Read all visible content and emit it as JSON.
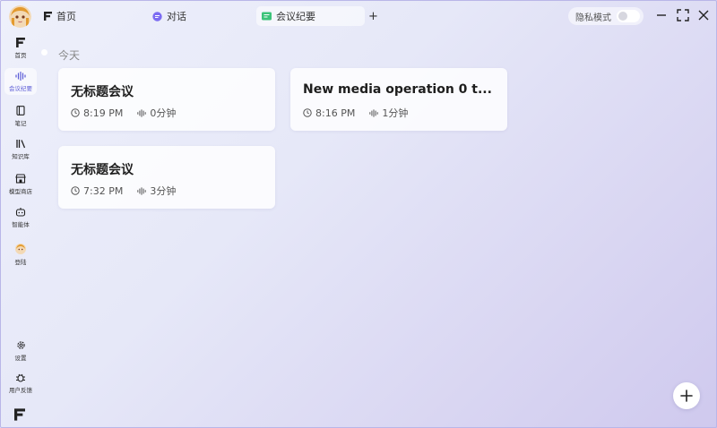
{
  "titlebar": {
    "tabs": [
      {
        "label": "首页"
      },
      {
        "label": "对话"
      },
      {
        "label": "会议纪要"
      }
    ],
    "add_tab": "+",
    "privacy_label": "隐私模式",
    "privacy_on": false
  },
  "sidebar": {
    "items": [
      {
        "label": "首页"
      },
      {
        "label": "会议纪要"
      },
      {
        "label": "笔记"
      },
      {
        "label": "知识库"
      },
      {
        "label": "模型商店"
      },
      {
        "label": "智能体"
      },
      {
        "label": "登陆"
      }
    ],
    "bottom": [
      {
        "label": "设置"
      },
      {
        "label": "用户反馈"
      }
    ]
  },
  "main": {
    "section": "今天",
    "cards": [
      {
        "title": "无标题会议",
        "time": "8:19 PM",
        "duration": "0分钟"
      },
      {
        "title": "New media operation 0 t...",
        "time": "8:16 PM",
        "duration": "1分钟"
      },
      {
        "title": "无标题会议",
        "time": "7:32 PM",
        "duration": "3分钟"
      }
    ]
  },
  "colors": {
    "accent": "#5b5bd6",
    "border": "#b9b6e8"
  }
}
